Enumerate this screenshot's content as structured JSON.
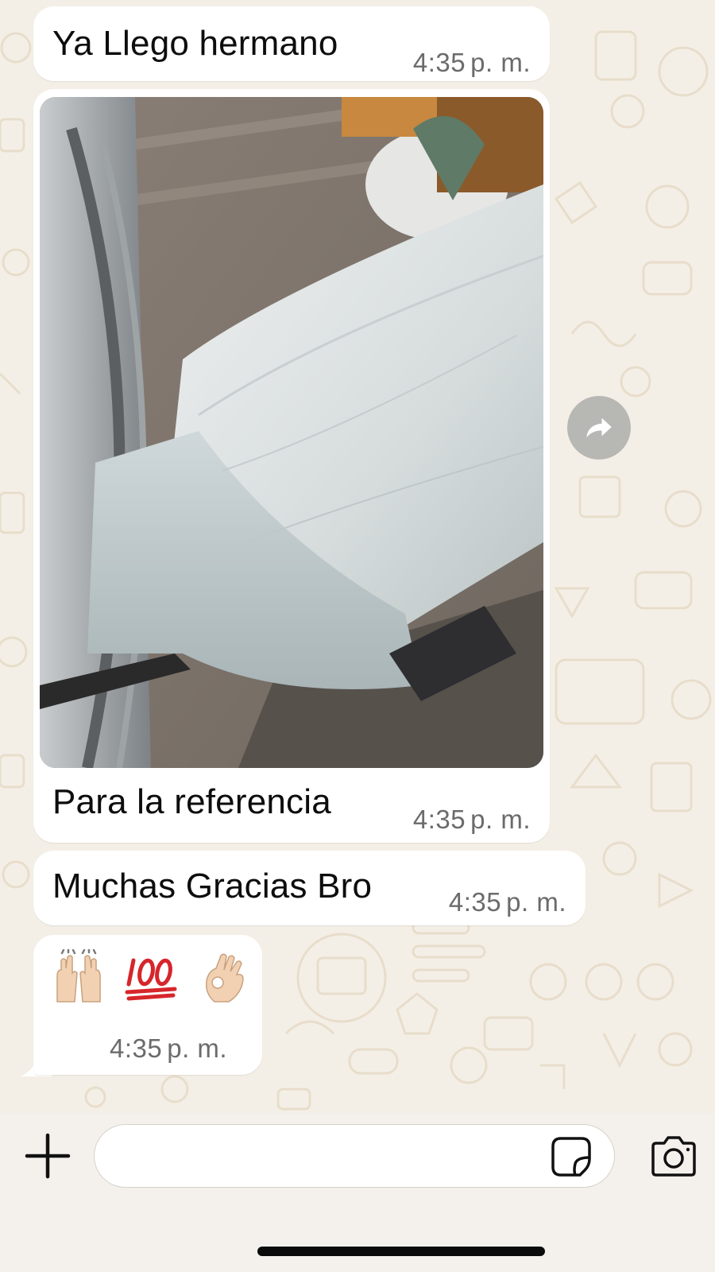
{
  "chat": {
    "messages": [
      {
        "text": "Ya Llego hermano",
        "time": "4:35",
        "ampm": "p. m."
      },
      {
        "caption": "Para la referencia",
        "time": "4:35",
        "ampm": "p. m.",
        "media_icon": "photo"
      },
      {
        "text": "Muchas Gracias Bro",
        "time": "4:35",
        "ampm": "p. m."
      },
      {
        "emojis": [
          "raising-hands",
          "hundred-points",
          "ok-hand"
        ],
        "time": "4:35",
        "ampm": "p. m."
      }
    ],
    "forward_icon": "forward-arrow-icon"
  },
  "composer": {
    "input_value": "",
    "icons": [
      "plus-icon",
      "sticker-icon",
      "camera-icon"
    ]
  },
  "colors": {
    "wallpaper": "#f4efe6",
    "bubble": "#ffffff",
    "timestamp": "#6b6b6b",
    "doodle": "#e9dfcf"
  }
}
